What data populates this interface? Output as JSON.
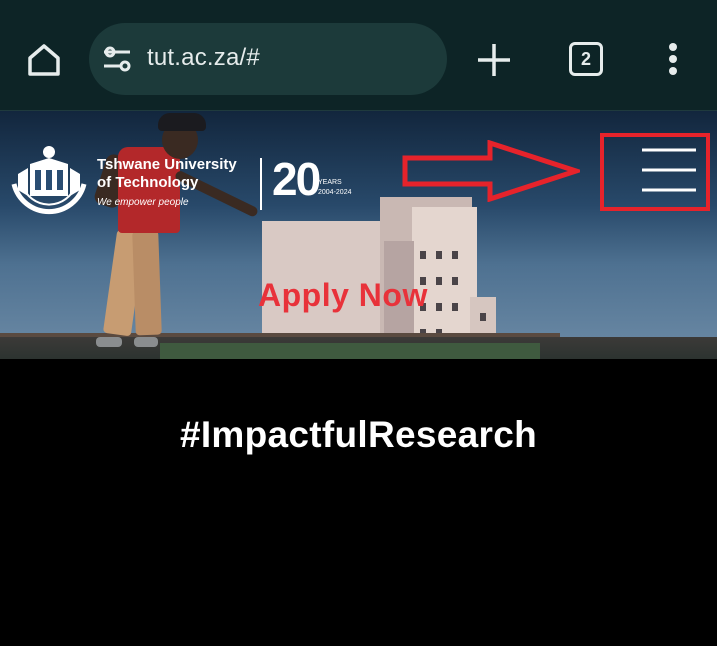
{
  "browser": {
    "url": "tut.ac.za/#",
    "tab_count": "2",
    "icons": {
      "home": "home-icon",
      "site_settings": "tune-icon",
      "new_tab": "plus-icon",
      "tabs": "tab-switcher-icon",
      "menu": "vertical-dots-icon"
    }
  },
  "site": {
    "logo": {
      "name_line1": "Tshwane University",
      "name_line2": "of Technology",
      "tagline": "We empower people",
      "anniversary_number": "20",
      "anniversary_label": "YEARS",
      "anniversary_range": "2004-2024"
    },
    "hero": {
      "cta": "Apply Now"
    },
    "nav_menu_icon": "hamburger-menu-icon",
    "headline": "#ImpactfulResearch"
  },
  "annotation": {
    "color": "#e6232b",
    "arrow_icon": "right-arrow-icon"
  },
  "colors": {
    "toolbar_bg": "#0d2426",
    "url_bar_bg": "#1c3a3a",
    "apply_now": "#e8323a",
    "page_bg": "#000000"
  }
}
